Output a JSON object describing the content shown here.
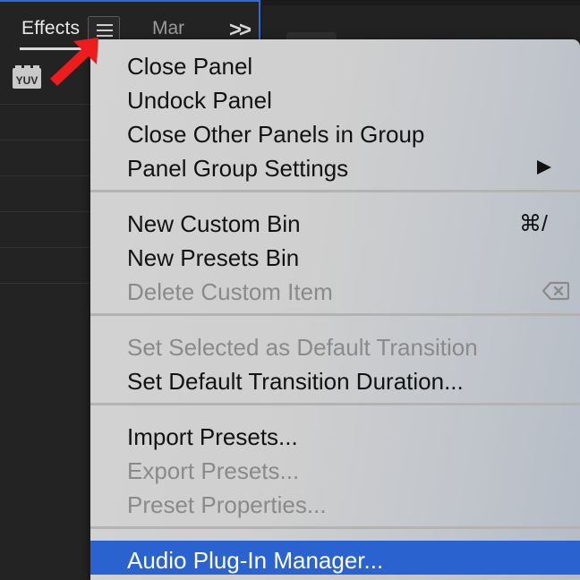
{
  "panel": {
    "tabs": [
      {
        "label": "Effects"
      },
      {
        "label": "Mar"
      }
    ],
    "icons": {
      "menu": "hamburger-menu-icon",
      "overflow": "double-chevron-right-icon",
      "yuv": "yuv-effect-icon"
    },
    "yuv_label": "YUV"
  },
  "menu": {
    "items": [
      {
        "label": "Close Panel",
        "enabled": true
      },
      {
        "label": "Undock Panel",
        "enabled": true
      },
      {
        "label": "Close Other Panels in Group",
        "enabled": true
      },
      {
        "label": "Panel Group Settings",
        "enabled": true,
        "submenu": true
      },
      {
        "label": "New Custom Bin",
        "enabled": true,
        "shortcut": "⌘/"
      },
      {
        "label": "New Presets Bin",
        "enabled": true
      },
      {
        "label": "Delete Custom Item",
        "enabled": false,
        "shortcut_icon": "backspace-icon"
      },
      {
        "label": "Set Selected as Default Transition",
        "enabled": false
      },
      {
        "label": "Set Default Transition Duration...",
        "enabled": true
      },
      {
        "label": "Import Presets...",
        "enabled": true
      },
      {
        "label": "Export Presets...",
        "enabled": false
      },
      {
        "label": "Preset Properties...",
        "enabled": false
      },
      {
        "label": "Audio Plug-In Manager...",
        "enabled": true,
        "highlighted": true
      }
    ]
  },
  "colors": {
    "highlight": "#2a63d0",
    "annotation_arrow": "#ee1c1c",
    "panel_focus_border": "#2e6bd6"
  }
}
